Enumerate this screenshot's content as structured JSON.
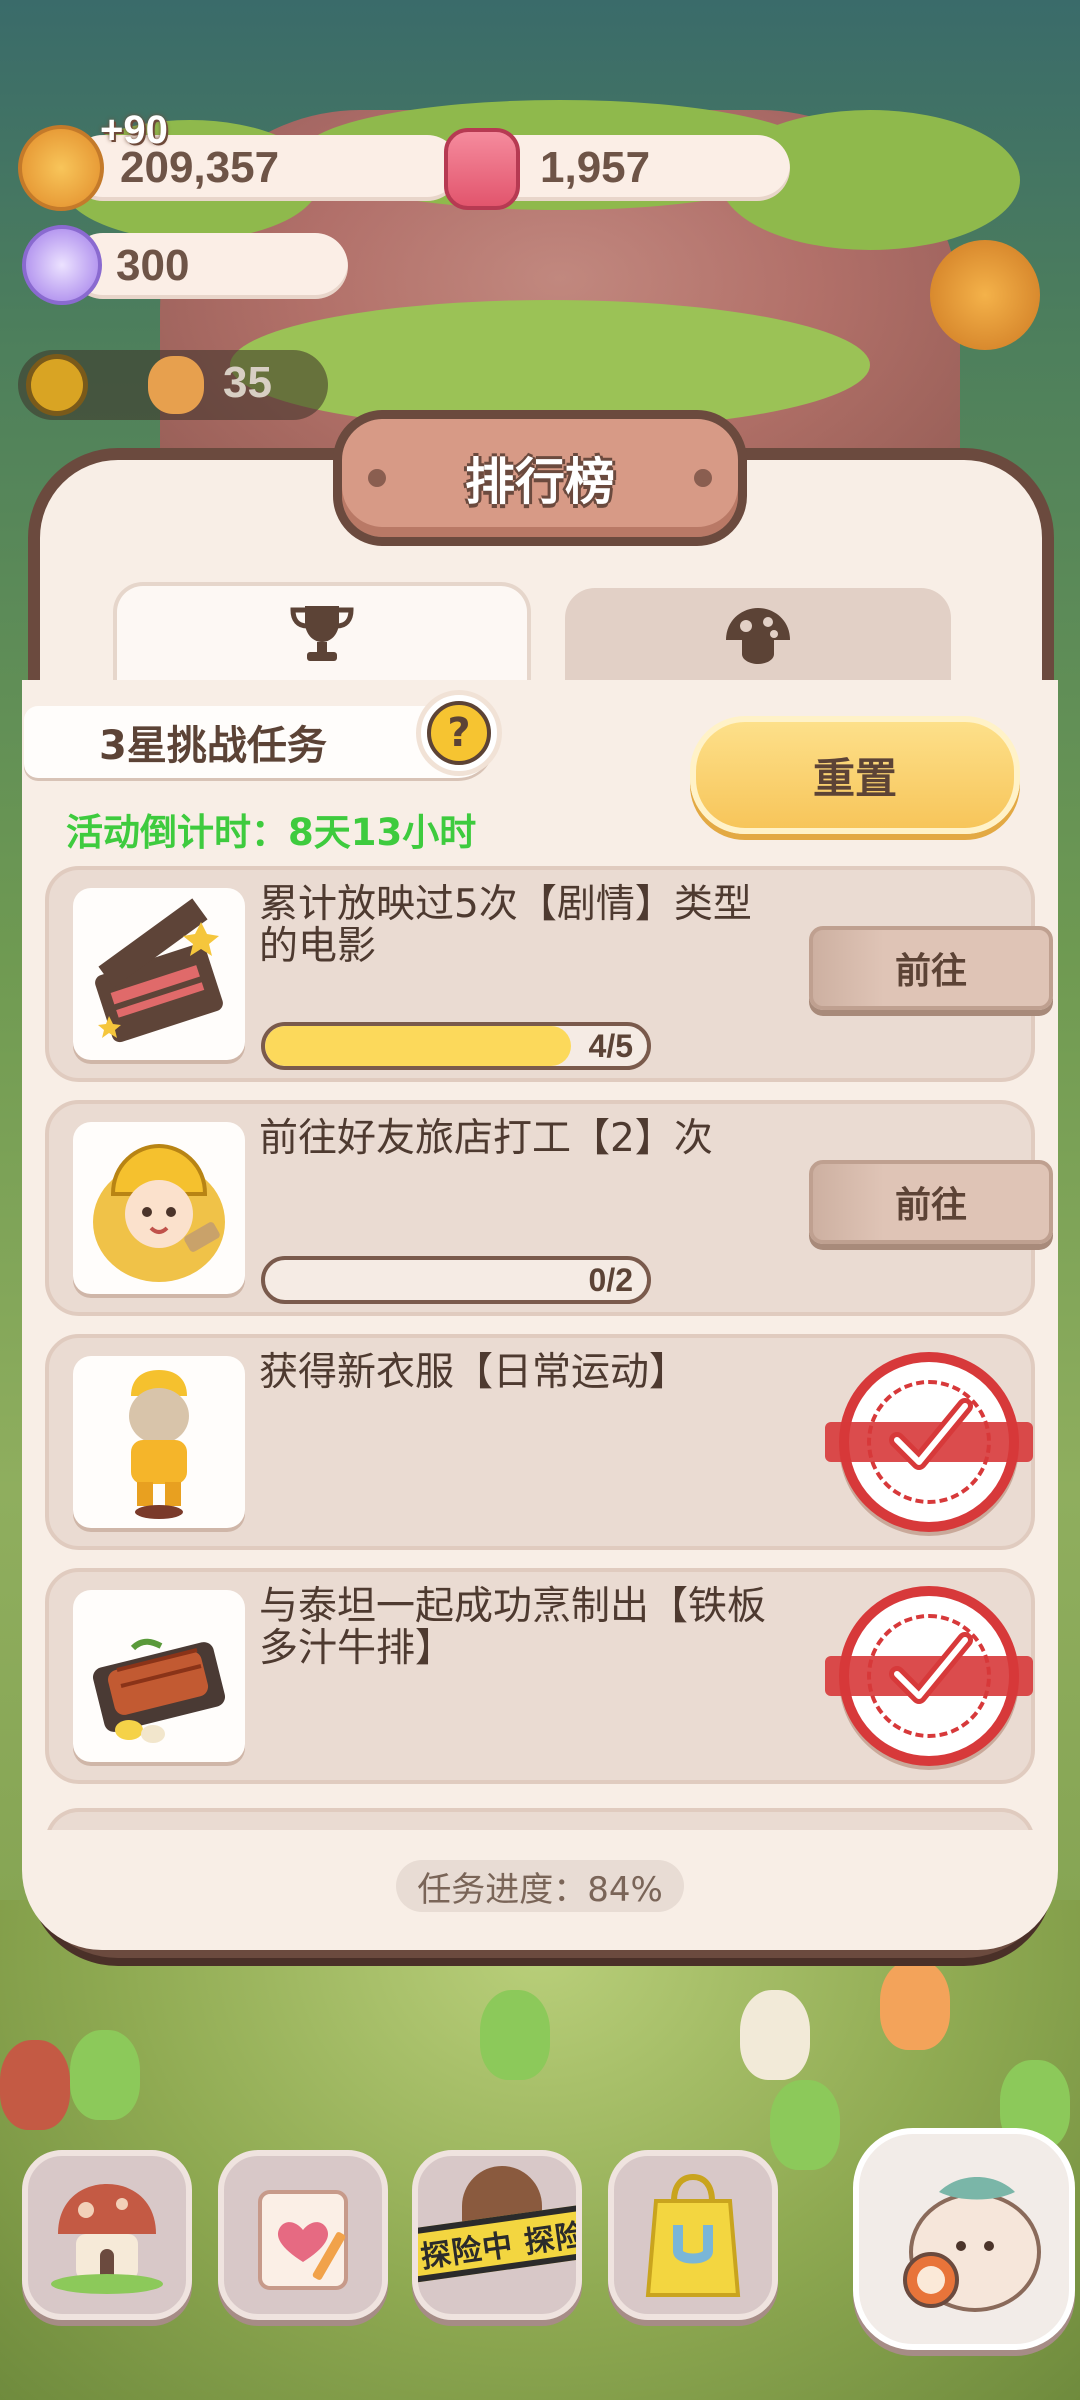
{
  "currencies": {
    "cookies": "209,357",
    "cookies_bonus": "+90",
    "gems": "1,957",
    "candy": "300",
    "coins": "35"
  },
  "modal": {
    "title": "排行榜",
    "tabs": [
      {
        "icon": "trophy-icon",
        "active": true
      },
      {
        "icon": "mushroom-icon",
        "active": false
      }
    ],
    "challenge_label": "3星挑战任务",
    "help_label": "?",
    "countdown": "活动倒计时：8天13小时",
    "reset_label": "重置",
    "tasks": [
      {
        "text": "累计放映过5次【剧情】类型的电影",
        "image": "clapperboard-icon",
        "progress_label": "4/5",
        "progress": 0.8,
        "action": "前往",
        "completed": false
      },
      {
        "text": "前往好友旅店打工【2】次",
        "image": "worker-character-icon",
        "progress_label": "0/2",
        "progress": 0,
        "action": "前往",
        "completed": false
      },
      {
        "text": "获得新衣服【日常运动】",
        "image": "outfit-character-icon",
        "completed": true
      },
      {
        "text": "与泰坦一起成功烹制出【铁板多汁牛排】",
        "image": "steak-plate-icon",
        "completed": true
      }
    ],
    "task_progress": "任务进度：84%"
  },
  "bottom_nav": {
    "explore_label": "探险中 探险",
    "items": [
      "house-icon",
      "diary-icon",
      "explore-icon",
      "shop-bag-icon",
      "fish-character-icon"
    ]
  },
  "colors": {
    "accent_yellow": "#fcd95b",
    "countdown_green": "#3ecb3e",
    "stamp_red": "#d7393a",
    "frame_brown": "#6b4a3e"
  }
}
